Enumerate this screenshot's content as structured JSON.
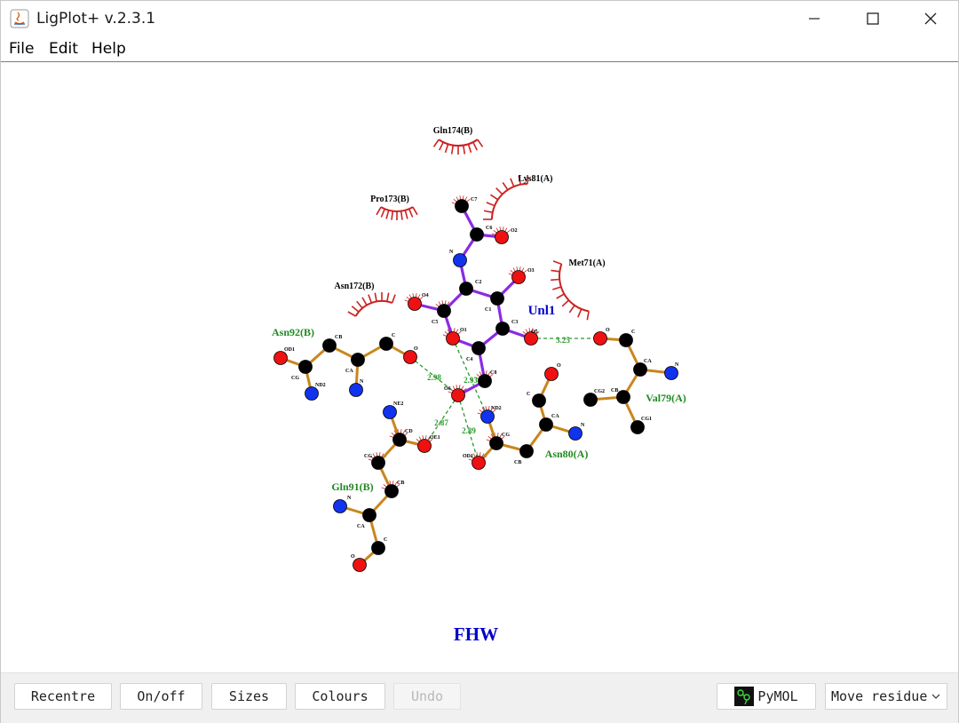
{
  "window": {
    "title": "LigPlot+ v.2.3.1"
  },
  "menu": [
    "File",
    "Edit",
    "Help"
  ],
  "ligand": {
    "name": "Unl1",
    "title": "FHW",
    "color": "#0000cc"
  },
  "colors": {
    "ligand_bond": "#8a2be2",
    "residue_bond": "#c8861c",
    "hbond": "#2a9a2a",
    "hydrophobic": "#cc2222",
    "residue_label": "#1f8a1f",
    "carbon": "#000000",
    "oxygen": "#ee1111",
    "nitrogen": "#1133ee"
  },
  "hydrophobic_residues": [
    "Gln174(B)",
    "Lys81(A)",
    "Pro173(B)",
    "Met71(A)",
    "Asn172(B)"
  ],
  "hbond_residues": [
    "Asn92(B)",
    "Val79(A)",
    "Gln91(B)",
    "Asn80(A)"
  ],
  "hbond_distances": [
    "3.25",
    "2.98",
    "2.93",
    "2.87",
    "2.89"
  ],
  "atom_labels": {
    "ligand": [
      "C7",
      "C6",
      "O2",
      "N",
      "O3",
      "C2",
      "C1",
      "C3",
      "O4",
      "C5",
      "O1",
      "O5",
      "C4",
      "C8",
      "O6"
    ],
    "asn92": [
      "OD1",
      "CB",
      "C",
      "O",
      "CG",
      "CA",
      "ND2",
      "N"
    ],
    "val79": [
      "O",
      "C",
      "CA",
      "N",
      "CG2",
      "CB",
      "CG1"
    ],
    "gln91": [
      "NE2",
      "CD",
      "OE1",
      "CG",
      "CB",
      "N",
      "CA",
      "C",
      "O"
    ],
    "asn80": [
      "O",
      "C",
      "ND2",
      "CA",
      "N",
      "CG",
      "OD1",
      "CB"
    ]
  },
  "toolbar": {
    "recentre": "Recentre",
    "onoff": "On/off",
    "sizes": "Sizes",
    "colours": "Colours",
    "undo": "Undo",
    "pymol": "PyMOL",
    "mode": "Move residue"
  }
}
